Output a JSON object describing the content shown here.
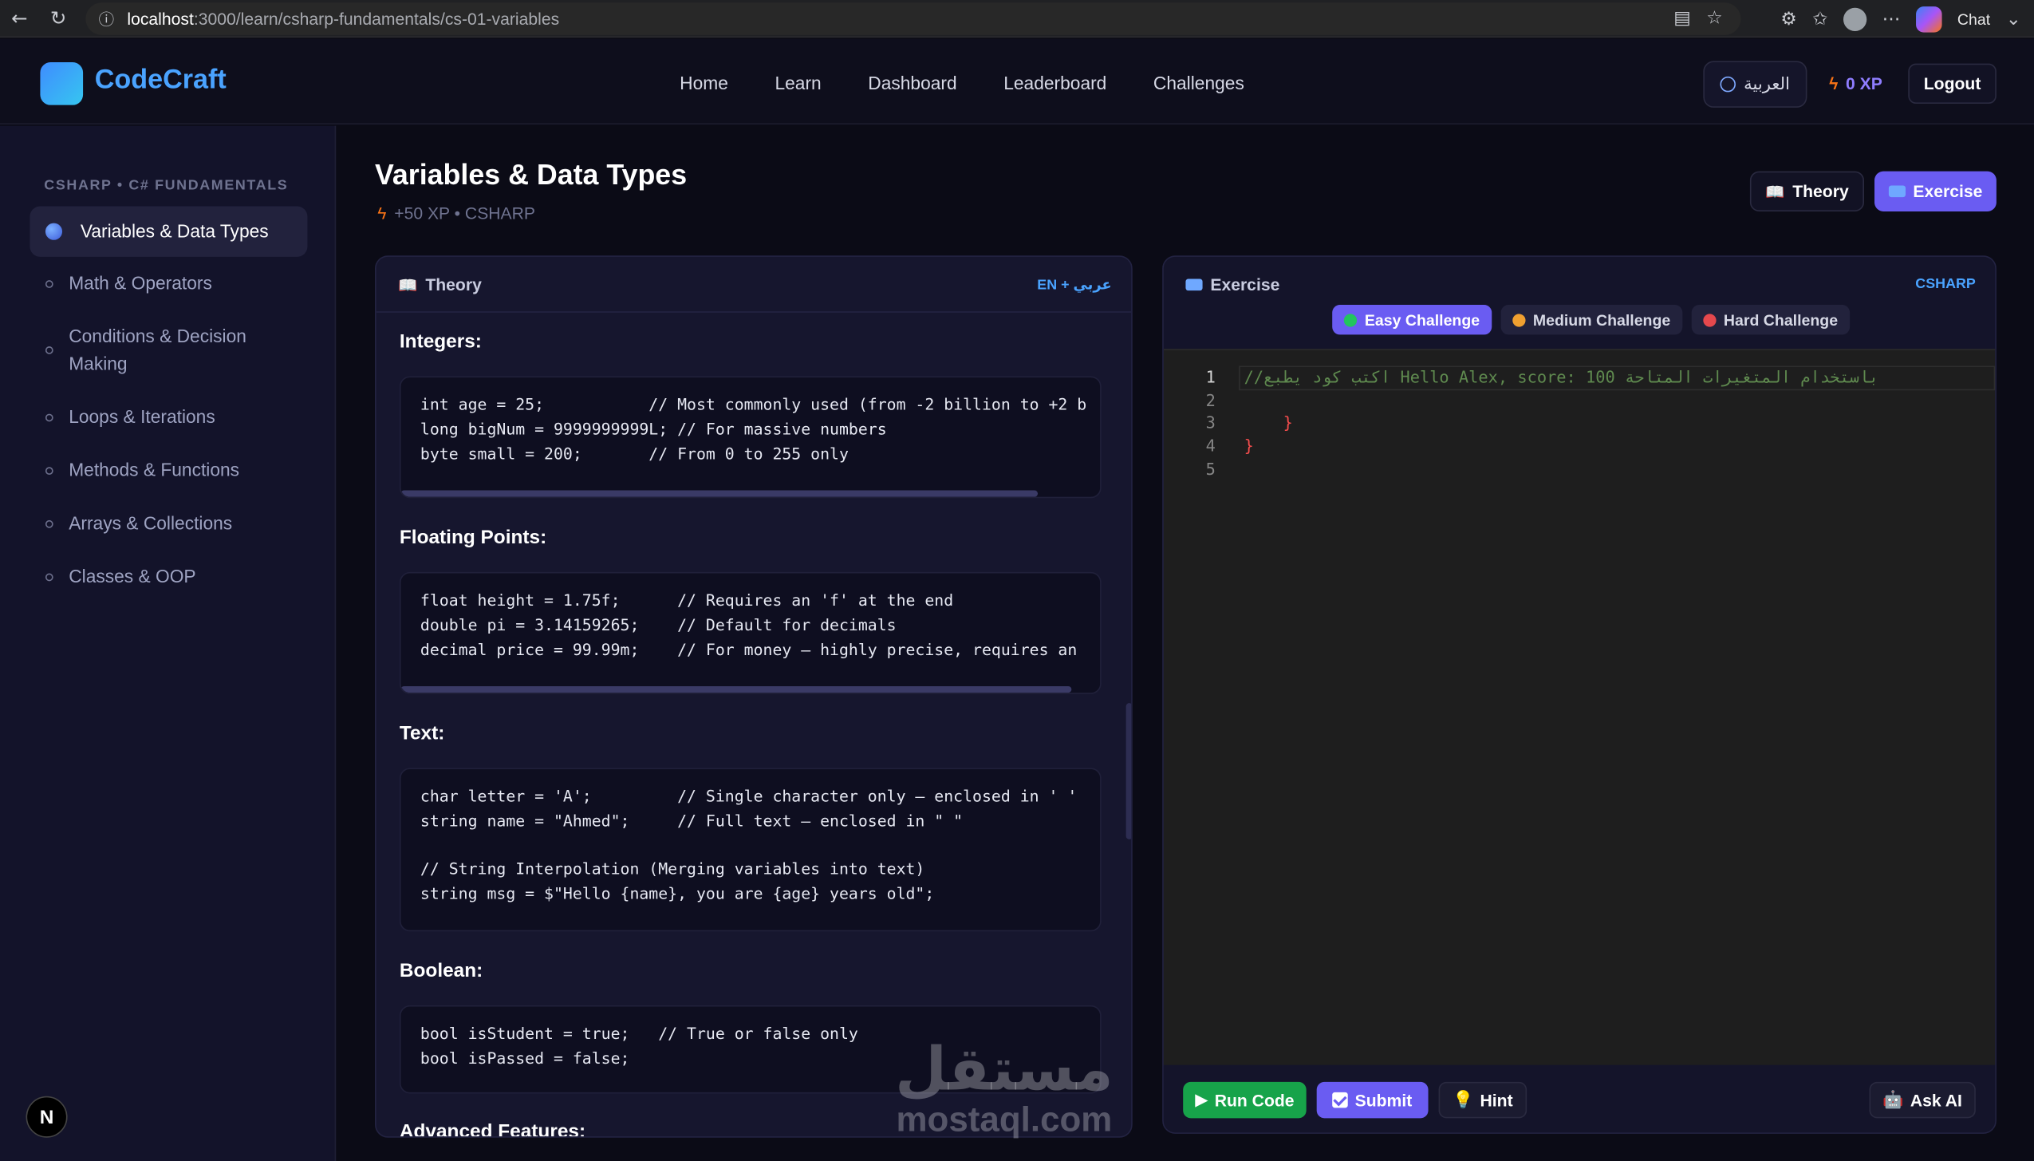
{
  "browser": {
    "url_host": "localhost",
    "url_path": ":3000/learn/csharp-fundamentals/cs-01-variables",
    "chat_label": "Chat"
  },
  "header": {
    "logo": "CodeCraft",
    "nav": [
      "Home",
      "Learn",
      "Dashboard",
      "Leaderboard",
      "Challenges"
    ],
    "language_button": "العربية",
    "xp": "0 XP",
    "logout": "Logout"
  },
  "sidebar": {
    "heading": "CSHARP • C# FUNDAMENTALS",
    "items": [
      {
        "label": "Variables & Data Types",
        "active": true
      },
      {
        "label": "Math & Operators"
      },
      {
        "label": "Conditions & Decision Making"
      },
      {
        "label": "Loops & Iterations"
      },
      {
        "label": "Methods & Functions"
      },
      {
        "label": "Arrays & Collections"
      },
      {
        "label": "Classes & OOP"
      }
    ]
  },
  "page": {
    "title": "Variables & Data Types",
    "meta": "+50 XP • CSHARP",
    "toggle_theory": "Theory",
    "toggle_exercise": "Exercise"
  },
  "theory": {
    "title": "Theory",
    "lang_tag": "EN + عربي",
    "sections": [
      {
        "heading": "Integers:",
        "code": "int age = 25;           // Most commonly used (from -2 billion to +2 b\nlong bigNum = 9999999999L; // For massive numbers\nbyte small = 200;       // From 0 to 255 only"
      },
      {
        "heading": "Floating Points:",
        "code": "float height = 1.75f;      // Requires an 'f' at the end\ndouble pi = 3.14159265;    // Default for decimals\ndecimal price = 99.99m;    // For money — highly precise, requires an"
      },
      {
        "heading": "Text:",
        "code": "char letter = 'A';         // Single character only — enclosed in ' '\nstring name = \"Ahmed\";     // Full text — enclosed in \" \"\n\n// String Interpolation (Merging variables into text)\nstring msg = $\"Hello {name}, you are {age} years old\";"
      },
      {
        "heading": "Boolean:",
        "code": "bool isStudent = true;   // True or false only\nbool isPassed = false;"
      },
      {
        "heading": "Advanced Features:",
        "code": ""
      }
    ]
  },
  "exercise": {
    "title": "Exercise",
    "lang_tag": "CSHARP",
    "difficulties": [
      {
        "label": "Easy Challenge",
        "color": "#22c55e",
        "active": true
      },
      {
        "label": "Medium Challenge",
        "color": "#f59e0b"
      },
      {
        "label": "Hard Challenge",
        "color": "#ef4444"
      }
    ],
    "editor_lines": [
      {
        "num": "1",
        "text": "//اكتب كود يطبع Hello Alex, score: 100 باستخدام المتغيرات المتاحة",
        "kind": "comment"
      },
      {
        "num": "2",
        "text": "",
        "kind": "plain"
      },
      {
        "num": "3",
        "text": "    }",
        "kind": "brace"
      },
      {
        "num": "4",
        "text": "}",
        "kind": "brace"
      },
      {
        "num": "5",
        "text": "",
        "kind": "plain"
      }
    ],
    "run": "Run Code",
    "submit": "Submit",
    "hint": "Hint",
    "ask_ai": "Ask AI"
  },
  "badge": "N",
  "watermark": {
    "arabic": "مستقل",
    "latin": "mostaql.com"
  }
}
